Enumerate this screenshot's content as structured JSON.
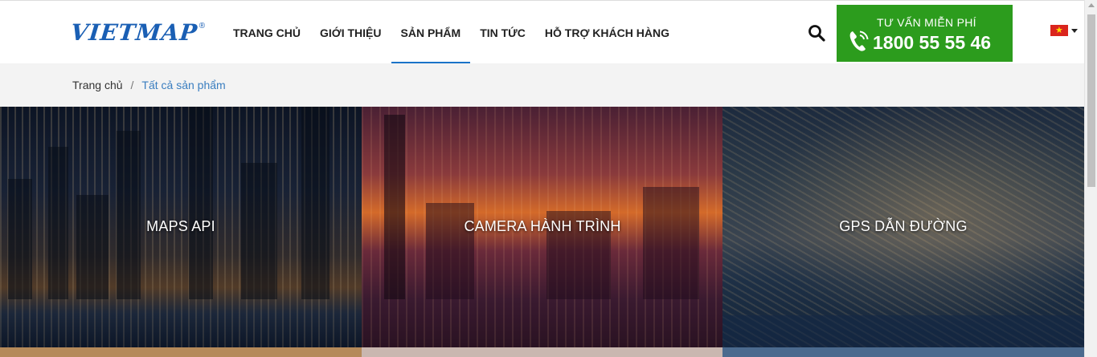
{
  "header": {
    "logo_text": "VIETMAP",
    "logo_mark": "®",
    "nav": [
      {
        "label": "TRANG CHỦ",
        "active": false
      },
      {
        "label": "GIỚI THIỆU",
        "active": false
      },
      {
        "label": "SẢN PHẨM",
        "active": true
      },
      {
        "label": "TIN TỨC",
        "active": false
      },
      {
        "label": "HỖ TRỢ KHÁCH HÀNG",
        "active": false
      }
    ],
    "search_icon": "search-icon",
    "hotline": {
      "label": "TƯ VẤN MIỄN PHÍ",
      "number": "1800 55 55 46",
      "icon": "phone-icon",
      "color": "#2c9c1d"
    },
    "language_icon": "vietnam-flag-icon"
  },
  "breadcrumb": {
    "home": "Trang chủ",
    "separator": "/",
    "current": "Tất cả sản phẩm"
  },
  "products": [
    {
      "label": "MAPS API"
    },
    {
      "label": "CAMERA HÀNH TRÌNH"
    },
    {
      "label": "GPS DẪN ĐƯỜNG"
    }
  ],
  "colors": {
    "accent": "#1a73c8",
    "logo": "#1a5fb4",
    "breadcrumb_link": "#3a7ec0"
  }
}
